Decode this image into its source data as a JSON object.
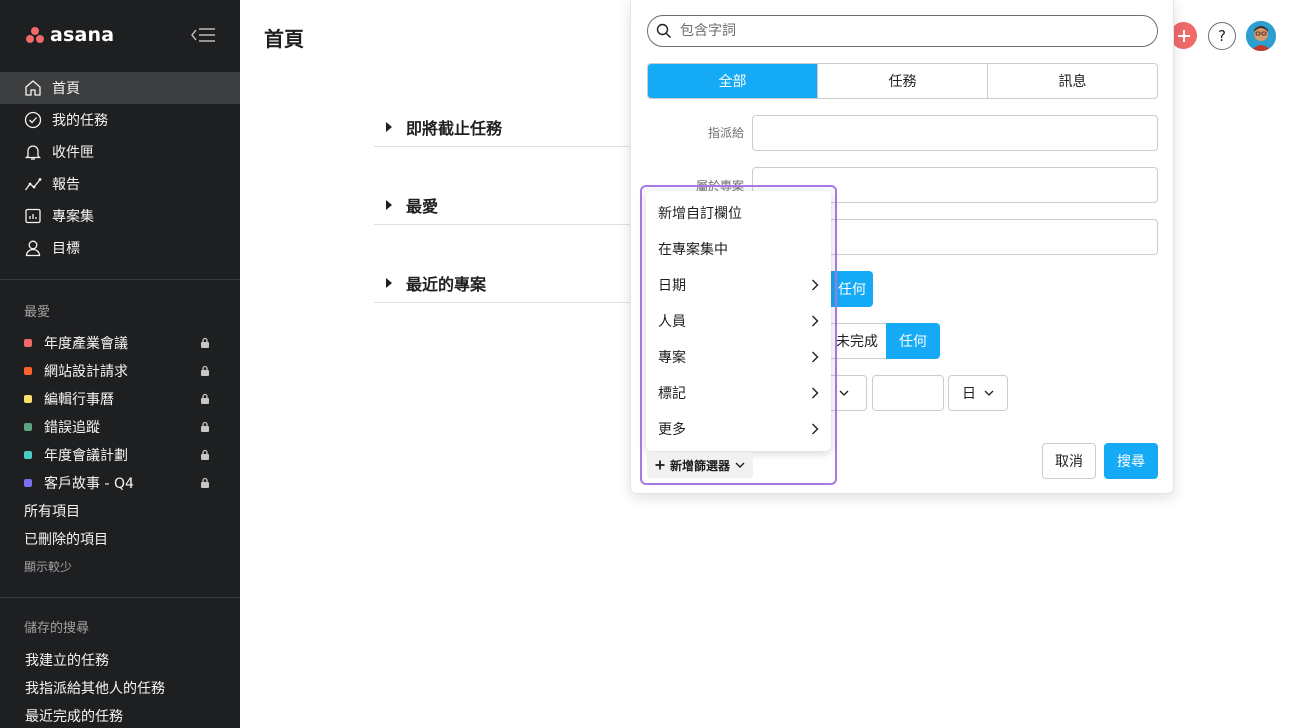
{
  "brand": {
    "logo_text": "asana",
    "accent": "#f06a6a",
    "sidebar_bg": "#1e1f21"
  },
  "sidebar": {
    "nav": [
      {
        "label": "首頁",
        "icon": "home-icon",
        "active": true
      },
      {
        "label": "我的任務",
        "icon": "check-circle-icon"
      },
      {
        "label": "收件匣",
        "icon": "bell-icon"
      },
      {
        "label": "報告",
        "icon": "line-chart-icon"
      },
      {
        "label": "專案集",
        "icon": "portfolio-icon"
      },
      {
        "label": "目標",
        "icon": "person-icon"
      }
    ],
    "favorites_title": "最愛",
    "favorites": [
      {
        "label": "年度產業會議",
        "color": "#f06a6a"
      },
      {
        "label": "網站設計請求",
        "color": "#fd612c"
      },
      {
        "label": "編輯行事曆",
        "color": "#f8df72"
      },
      {
        "label": "錯誤追蹤",
        "color": "#5da283"
      },
      {
        "label": "年度會議計劃",
        "color": "#4ecbc4"
      },
      {
        "label": "客戶故事 - Q4",
        "color": "#7a6ff0"
      }
    ],
    "all_items": "所有項目",
    "deleted_items": "已刪除的項目",
    "show_less": "顯示較少",
    "saved_title": "儲存的搜尋",
    "saved": [
      {
        "label": "我建立的任務"
      },
      {
        "label": "我指派給其他人的任務"
      },
      {
        "label": "最近完成的任務"
      }
    ]
  },
  "main": {
    "title": "首頁",
    "sections": [
      {
        "label": "即將截止任務"
      },
      {
        "label": "最愛"
      },
      {
        "label": "最近的專案"
      }
    ]
  },
  "search_panel": {
    "placeholder": "包含字詞",
    "tabs": [
      "全部",
      "任務",
      "訊息"
    ],
    "assigned_label": "指派給",
    "project_label": "屬於專案",
    "any_label": "任何",
    "incomplete_label": "未完成",
    "any_label_2": "任何",
    "date_unit": "日",
    "cancel": "取消",
    "search": "搜尋",
    "add_filter": "新增篩選器"
  },
  "filter_menu": [
    {
      "label": "新增自訂欄位",
      "submenu": false
    },
    {
      "label": "在專案集中",
      "submenu": false
    },
    {
      "label": "日期",
      "submenu": true
    },
    {
      "label": "人員",
      "submenu": true
    },
    {
      "label": "專案",
      "submenu": true
    },
    {
      "label": "標記",
      "submenu": true
    },
    {
      "label": "更多",
      "submenu": true
    }
  ]
}
